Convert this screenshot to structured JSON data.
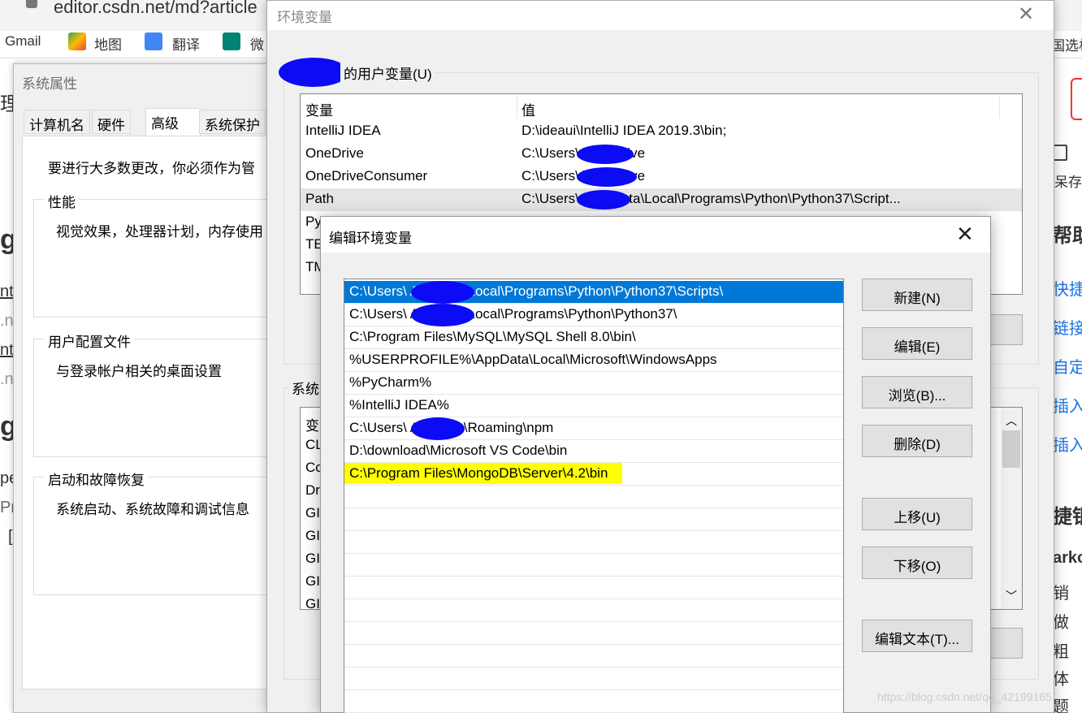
{
  "browser": {
    "url": "editor.csdn.net/md?article",
    "bookmarks": [
      "Gmail",
      "地图",
      "翻译",
      "微"
    ]
  },
  "background_page": {
    "left_fragments": [
      "理",
      "g",
      "nt",
      ".n",
      "nt",
      ".n",
      "g",
      "pe",
      "Pr",
      "["
    ],
    "right_fragments": [
      "国选枋",
      "呆存",
      "帮助",
      "快捷银",
      "链接",
      "自定义",
      "插入",
      "插入",
      "捷银",
      "arko",
      "销",
      "做",
      "粗",
      "体",
      "题"
    ]
  },
  "system_properties": {
    "title": "系统属性",
    "tabs": [
      "计算机名",
      "硬件",
      "高级",
      "系统保护"
    ],
    "active_tab": "高级",
    "admin_note": "要进行大多数更改，你必须作为管",
    "groups": [
      {
        "title": "性能",
        "text": "视觉效果，处理器计划，内存使用"
      },
      {
        "title": "用户配置文件",
        "text": "与登录帐户相关的桌面设置"
      },
      {
        "title": "启动和故障恢复",
        "text": "系统启动、系统故障和调试信息"
      }
    ]
  },
  "env_window": {
    "title": "环境变量",
    "user_group_label": "的用户变量(U)",
    "columns": [
      "变量",
      "值"
    ],
    "user_vars": [
      {
        "name": "IntelliJ IDEA",
        "value": "D:\\ideaui\\IntelliJ IDEA 2019.3\\bin;"
      },
      {
        "name": "OneDrive",
        "value": "C:\\Users\\          \\OneDrive"
      },
      {
        "name": "OneDriveConsumer",
        "value": "C:\\Users\\          \\OneDrive"
      },
      {
        "name": "Path",
        "value": "C:\\Users\\          \\AppData\\Local\\Programs\\Python\\Python37\\Script..."
      },
      {
        "name": "Py",
        "value": ""
      },
      {
        "name": "TE",
        "value": ""
      },
      {
        "name": "TM",
        "value": ""
      }
    ],
    "system_group_label": "系统",
    "system_vars_header": "变",
    "system_vars": [
      "CL",
      "Co",
      "Dr",
      "GI",
      "GI",
      "GI",
      "GI",
      "GI"
    ]
  },
  "edit_dialog": {
    "title": "编辑环境变量",
    "paths": [
      "C:\\Users\\           AppData\\Local\\Programs\\Python\\Python37\\Scripts\\",
      "C:\\Users\\           AppData\\Local\\Programs\\Python\\Python37\\",
      "C:\\Program Files\\MySQL\\MySQL Shell 8.0\\bin\\",
      "%USERPROFILE%\\AppData\\Local\\Microsoft\\WindowsApps",
      "%PyCharm%",
      "%IntelliJ IDEA%",
      "C:\\Users\\           AppData\\Roaming\\npm",
      "D:\\download\\Microsoft VS Code\\bin",
      "C:\\Program Files\\MongoDB\\Server\\4.2\\bin"
    ],
    "selected_index": 0,
    "highlighted_index": 8,
    "highlight_color": "#ffff00",
    "selection_color": "#0078d7",
    "buttons": {
      "new": "新建(N)",
      "edit": "编辑(E)",
      "browse": "浏览(B)...",
      "delete": "删除(D)",
      "move_up": "上移(U)",
      "move_down": "下移(O)",
      "edit_text": "编辑文本(T)..."
    }
  },
  "watermark": "https://blog.csdn.net/qq_42199165"
}
